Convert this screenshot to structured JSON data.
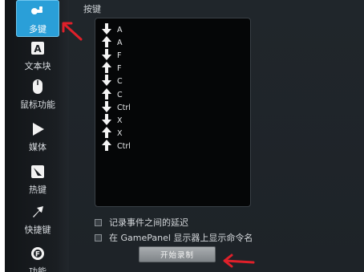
{
  "sidebar": {
    "items": [
      {
        "label": "多键",
        "icon": "multikey-icon",
        "active": true
      },
      {
        "label": "文本块",
        "icon": "text-block-icon"
      },
      {
        "label": "鼠标功能",
        "icon": "mouse-icon"
      },
      {
        "label": "媒体",
        "icon": "play-icon"
      },
      {
        "label": "热键",
        "icon": "hotkey-icon"
      },
      {
        "label": "快捷键",
        "icon": "shortcut-arrow-icon"
      },
      {
        "label": "功能",
        "icon": "function-icon"
      }
    ]
  },
  "main": {
    "section_title": "按键",
    "keystrokes": [
      {
        "key": "A",
        "direction": "down"
      },
      {
        "key": "A",
        "direction": "up"
      },
      {
        "key": "F",
        "direction": "down"
      },
      {
        "key": "F",
        "direction": "up"
      },
      {
        "key": "C",
        "direction": "down"
      },
      {
        "key": "C",
        "direction": "up"
      },
      {
        "key": "Ctrl",
        "direction": "down"
      },
      {
        "key": "X",
        "direction": "down"
      },
      {
        "key": "X",
        "direction": "up"
      },
      {
        "key": "Ctrl",
        "direction": "up"
      }
    ],
    "options": [
      {
        "label": "记录事件之间的延迟",
        "checked": false
      },
      {
        "label": "在 GamePanel 显示器上显示命令名",
        "checked": false
      }
    ],
    "record_button": "开始录制"
  },
  "colors": {
    "accent": "#2a9fd8",
    "annotation_arrow": "#e0202a",
    "list_background": "#050607"
  }
}
